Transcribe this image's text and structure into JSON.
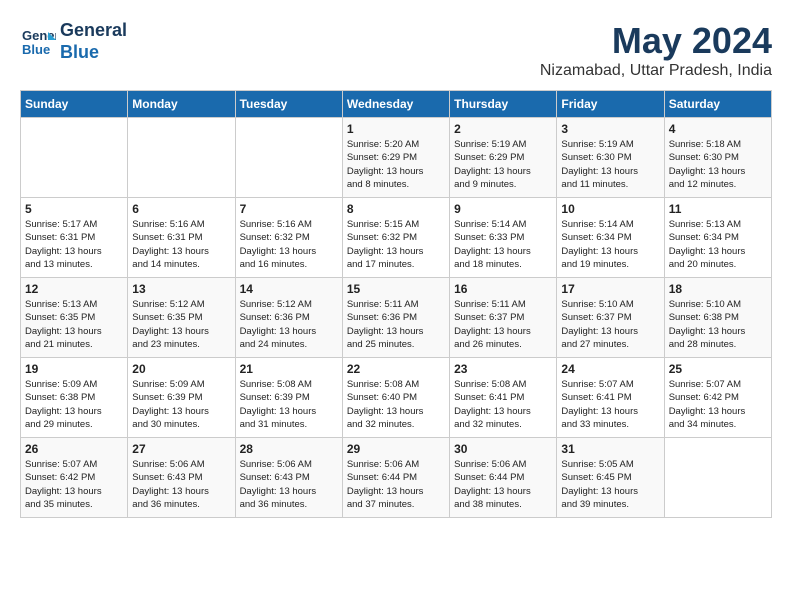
{
  "header": {
    "logo_line1": "General",
    "logo_line2": "Blue",
    "month_year": "May 2024",
    "location": "Nizamabad, Uttar Pradesh, India"
  },
  "days_of_week": [
    "Sunday",
    "Monday",
    "Tuesday",
    "Wednesday",
    "Thursday",
    "Friday",
    "Saturday"
  ],
  "weeks": [
    [
      {
        "day": "",
        "info": ""
      },
      {
        "day": "",
        "info": ""
      },
      {
        "day": "",
        "info": ""
      },
      {
        "day": "1",
        "info": "Sunrise: 5:20 AM\nSunset: 6:29 PM\nDaylight: 13 hours\nand 8 minutes."
      },
      {
        "day": "2",
        "info": "Sunrise: 5:19 AM\nSunset: 6:29 PM\nDaylight: 13 hours\nand 9 minutes."
      },
      {
        "day": "3",
        "info": "Sunrise: 5:19 AM\nSunset: 6:30 PM\nDaylight: 13 hours\nand 11 minutes."
      },
      {
        "day": "4",
        "info": "Sunrise: 5:18 AM\nSunset: 6:30 PM\nDaylight: 13 hours\nand 12 minutes."
      }
    ],
    [
      {
        "day": "5",
        "info": "Sunrise: 5:17 AM\nSunset: 6:31 PM\nDaylight: 13 hours\nand 13 minutes."
      },
      {
        "day": "6",
        "info": "Sunrise: 5:16 AM\nSunset: 6:31 PM\nDaylight: 13 hours\nand 14 minutes."
      },
      {
        "day": "7",
        "info": "Sunrise: 5:16 AM\nSunset: 6:32 PM\nDaylight: 13 hours\nand 16 minutes."
      },
      {
        "day": "8",
        "info": "Sunrise: 5:15 AM\nSunset: 6:32 PM\nDaylight: 13 hours\nand 17 minutes."
      },
      {
        "day": "9",
        "info": "Sunrise: 5:14 AM\nSunset: 6:33 PM\nDaylight: 13 hours\nand 18 minutes."
      },
      {
        "day": "10",
        "info": "Sunrise: 5:14 AM\nSunset: 6:34 PM\nDaylight: 13 hours\nand 19 minutes."
      },
      {
        "day": "11",
        "info": "Sunrise: 5:13 AM\nSunset: 6:34 PM\nDaylight: 13 hours\nand 20 minutes."
      }
    ],
    [
      {
        "day": "12",
        "info": "Sunrise: 5:13 AM\nSunset: 6:35 PM\nDaylight: 13 hours\nand 21 minutes."
      },
      {
        "day": "13",
        "info": "Sunrise: 5:12 AM\nSunset: 6:35 PM\nDaylight: 13 hours\nand 23 minutes."
      },
      {
        "day": "14",
        "info": "Sunrise: 5:12 AM\nSunset: 6:36 PM\nDaylight: 13 hours\nand 24 minutes."
      },
      {
        "day": "15",
        "info": "Sunrise: 5:11 AM\nSunset: 6:36 PM\nDaylight: 13 hours\nand 25 minutes."
      },
      {
        "day": "16",
        "info": "Sunrise: 5:11 AM\nSunset: 6:37 PM\nDaylight: 13 hours\nand 26 minutes."
      },
      {
        "day": "17",
        "info": "Sunrise: 5:10 AM\nSunset: 6:37 PM\nDaylight: 13 hours\nand 27 minutes."
      },
      {
        "day": "18",
        "info": "Sunrise: 5:10 AM\nSunset: 6:38 PM\nDaylight: 13 hours\nand 28 minutes."
      }
    ],
    [
      {
        "day": "19",
        "info": "Sunrise: 5:09 AM\nSunset: 6:38 PM\nDaylight: 13 hours\nand 29 minutes."
      },
      {
        "day": "20",
        "info": "Sunrise: 5:09 AM\nSunset: 6:39 PM\nDaylight: 13 hours\nand 30 minutes."
      },
      {
        "day": "21",
        "info": "Sunrise: 5:08 AM\nSunset: 6:39 PM\nDaylight: 13 hours\nand 31 minutes."
      },
      {
        "day": "22",
        "info": "Sunrise: 5:08 AM\nSunset: 6:40 PM\nDaylight: 13 hours\nand 32 minutes."
      },
      {
        "day": "23",
        "info": "Sunrise: 5:08 AM\nSunset: 6:41 PM\nDaylight: 13 hours\nand 32 minutes."
      },
      {
        "day": "24",
        "info": "Sunrise: 5:07 AM\nSunset: 6:41 PM\nDaylight: 13 hours\nand 33 minutes."
      },
      {
        "day": "25",
        "info": "Sunrise: 5:07 AM\nSunset: 6:42 PM\nDaylight: 13 hours\nand 34 minutes."
      }
    ],
    [
      {
        "day": "26",
        "info": "Sunrise: 5:07 AM\nSunset: 6:42 PM\nDaylight: 13 hours\nand 35 minutes."
      },
      {
        "day": "27",
        "info": "Sunrise: 5:06 AM\nSunset: 6:43 PM\nDaylight: 13 hours\nand 36 minutes."
      },
      {
        "day": "28",
        "info": "Sunrise: 5:06 AM\nSunset: 6:43 PM\nDaylight: 13 hours\nand 36 minutes."
      },
      {
        "day": "29",
        "info": "Sunrise: 5:06 AM\nSunset: 6:44 PM\nDaylight: 13 hours\nand 37 minutes."
      },
      {
        "day": "30",
        "info": "Sunrise: 5:06 AM\nSunset: 6:44 PM\nDaylight: 13 hours\nand 38 minutes."
      },
      {
        "day": "31",
        "info": "Sunrise: 5:05 AM\nSunset: 6:45 PM\nDaylight: 13 hours\nand 39 minutes."
      },
      {
        "day": "",
        "info": ""
      }
    ]
  ]
}
